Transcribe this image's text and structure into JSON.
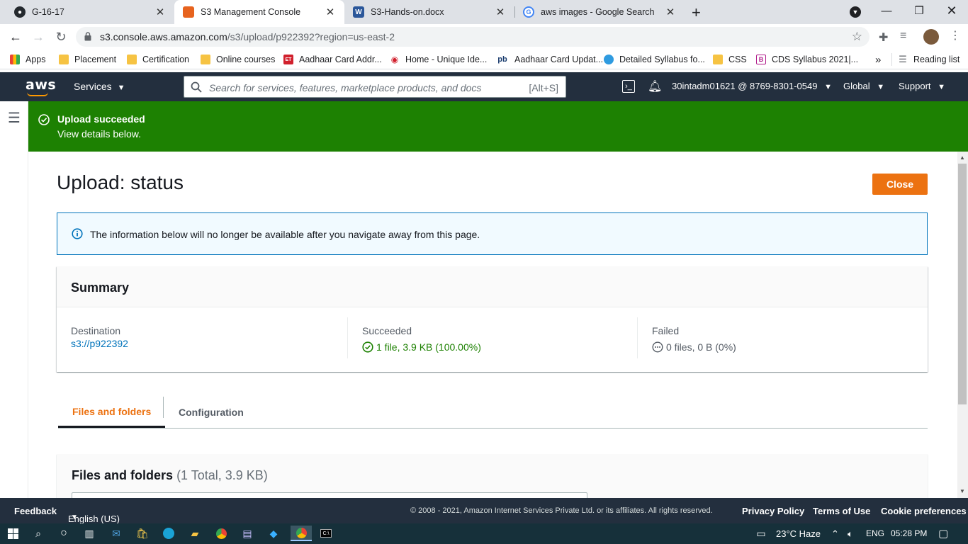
{
  "browser": {
    "tabs": [
      {
        "title": "G-16-17",
        "icon": "github-icon"
      },
      {
        "title": "S3 Management Console",
        "icon": "aws-s3-icon"
      },
      {
        "title": "S3-Hands-on.docx",
        "icon": "word-icon"
      },
      {
        "title": "aws images - Google Search",
        "icon": "google-icon"
      }
    ],
    "new_tab": "+",
    "url_host": "s3.console.aws.amazon.com",
    "url_path": "/s3/upload/p922392?region=us-east-2",
    "bookmarks": [
      "Apps",
      "Placement",
      "Certification",
      "Online courses",
      "Aadhaar Card Addr...",
      "Home - Unique Ide...",
      "Aadhaar Card Updat...",
      "Detailed Syllabus fo...",
      "CSS",
      "CDS Syllabus 2021|..."
    ],
    "more_bookmarks": "»",
    "reading_list": "Reading list"
  },
  "aws_nav": {
    "logo": "aws",
    "services": "Services",
    "search_placeholder": "Search for services, features, marketplace products, and docs",
    "search_shortcut": "[Alt+S]",
    "account": "30intadm01621 @ 8769-8301-0549",
    "region": "Global",
    "support": "Support"
  },
  "flash": {
    "title": "Upload succeeded",
    "message": "View details below."
  },
  "page": {
    "title": "Upload: status",
    "close_label": "Close",
    "info_text": "The information below will no longer be available after you navigate away from this page."
  },
  "summary": {
    "heading": "Summary",
    "destination_label": "Destination",
    "destination_value": "s3://p922392",
    "succeeded_label": "Succeeded",
    "succeeded_value": "1 file, 3.9 KB (100.00%)",
    "failed_label": "Failed",
    "failed_value": "0 files, 0 B (0%)"
  },
  "content_tabs": [
    {
      "label": "Files and folders",
      "active": true
    },
    {
      "label": "Configuration",
      "active": false
    }
  ],
  "files_panel": {
    "heading": "Files and folders",
    "count": "(1 Total, 3.9 KB)"
  },
  "footer": {
    "feedback": "Feedback",
    "language": "English (US)",
    "copyright": "© 2008 - 2021, Amazon Internet Services Private Ltd. or its affiliates. All rights reserved.",
    "privacy": "Privacy Policy",
    "terms": "Terms of Use",
    "cookies": "Cookie preferences"
  },
  "taskbar": {
    "weather": "23°C  Haze",
    "lang": "ENG",
    "time": "05:28 PM"
  },
  "colors": {
    "aws_nav_bg": "#232f3e",
    "success_green": "#1d8102",
    "primary_orange": "#ec7211",
    "link_blue": "#0073bb"
  }
}
